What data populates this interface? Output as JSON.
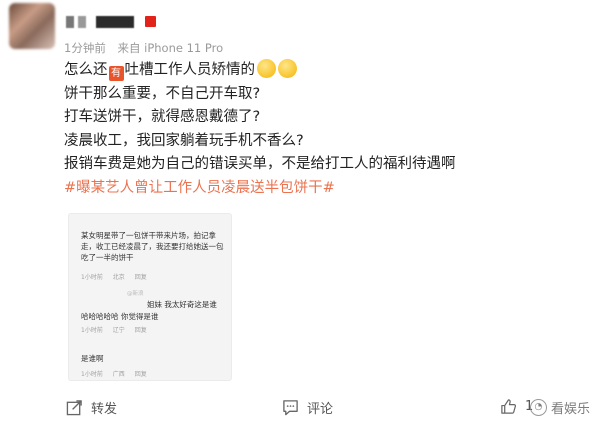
{
  "post": {
    "meta": {
      "time": "1分钟前",
      "source": "来自 iPhone 11 Pro"
    },
    "lines": {
      "l1_before": "怎么还",
      "l1_icon": "有",
      "l1_after": "吐槽工作人员矫情的",
      "l2": "饼干那么重要，不自己开车取?",
      "l3": "打车送饼干，就得感恩戴德了?",
      "l4": "凌晨收工，我回家躺着玩手机不香么?",
      "l5": "报销车费是她为自己的错误买单，不是给打工人的福利待遇啊",
      "hashtag": "#曝某艺人曾让工作人员凌晨送半包饼干#"
    }
  },
  "embedded_image": {
    "c1_text": "某女明星带了一包饼干带来片场，拍记拿走，收工已经凌晨了，我还要打给她送一包吃了一半的饼干",
    "c1_meta": {
      "time": "1小时前",
      "place": "北京",
      "reply": "回复"
    },
    "watermark": "@新浪",
    "c2_text_top": "姐妹 我太好奇这是谁",
    "c2_text_bottom": "哈哈哈哈哈 你觉得是谁",
    "c2_meta": {
      "time": "1小时前",
      "place": "辽宁",
      "reply": "回复"
    },
    "c3_text": "是谁啊",
    "c3_meta": {
      "time": "1小时前",
      "place": "广西",
      "reply": "回复"
    }
  },
  "footer": {
    "share": {
      "icon": "share-icon",
      "label": "转发"
    },
    "comment": {
      "icon": "comment-icon",
      "label": "评论"
    },
    "like": {
      "icon": "thumbs-up-icon",
      "count": "1"
    },
    "watermark": "看娱乐"
  },
  "colors": {
    "hashtag": "#eb7350",
    "brand_red": "#e2231a"
  }
}
